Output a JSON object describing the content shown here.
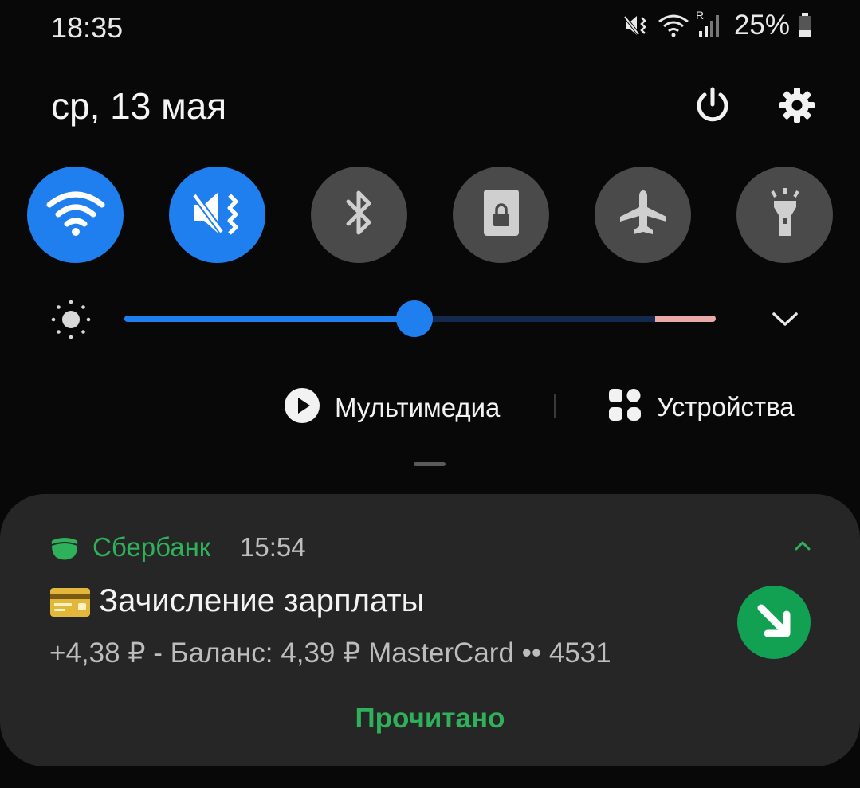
{
  "status_bar": {
    "time": "18:35",
    "battery_percent": "25%",
    "icons": [
      "vibrate-icon",
      "wifi-icon",
      "signal-icon",
      "battery-icon"
    ],
    "signal_tag": "R"
  },
  "header": {
    "date": "ср, 13 мая",
    "power_icon": "power-icon",
    "settings_icon": "gear-icon"
  },
  "quick_toggles": [
    {
      "icon": "wifi-icon",
      "state": "on"
    },
    {
      "icon": "vibrate-icon",
      "state": "on"
    },
    {
      "icon": "bluetooth-icon",
      "state": "off"
    },
    {
      "icon": "portrait-lock-icon",
      "state": "off"
    },
    {
      "icon": "airplane-icon",
      "state": "off"
    },
    {
      "icon": "flashlight-icon",
      "state": "off"
    }
  ],
  "brightness": {
    "level": 0.49,
    "expand_icon": "chevron-down-icon"
  },
  "media_panel": {
    "media_label": "Мультимедиа",
    "devices_label": "Устройства"
  },
  "notification": {
    "app_name": "Сбербанк",
    "time": "15:54",
    "title": "Зачисление зарплаты",
    "body": "+4,38 ₽ - Баланс: 4,39 ₽ MasterCard •• 4531",
    "action_label": "Прочитано",
    "accent": "#2fb05a",
    "action_icon_bg": "#12a153"
  },
  "colors": {
    "toggle_on": "#1f7fee",
    "toggle_off": "#4a4a4a",
    "background": "#080808"
  }
}
